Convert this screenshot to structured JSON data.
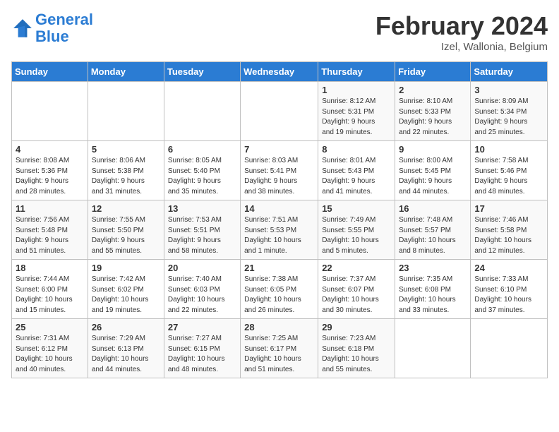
{
  "header": {
    "logo_line1": "General",
    "logo_line2": "Blue",
    "month": "February 2024",
    "location": "Izel, Wallonia, Belgium"
  },
  "weekdays": [
    "Sunday",
    "Monday",
    "Tuesday",
    "Wednesday",
    "Thursday",
    "Friday",
    "Saturday"
  ],
  "weeks": [
    [
      {
        "day": "",
        "info": ""
      },
      {
        "day": "",
        "info": ""
      },
      {
        "day": "",
        "info": ""
      },
      {
        "day": "",
        "info": ""
      },
      {
        "day": "1",
        "info": "Sunrise: 8:12 AM\nSunset: 5:31 PM\nDaylight: 9 hours\nand 19 minutes."
      },
      {
        "day": "2",
        "info": "Sunrise: 8:10 AM\nSunset: 5:33 PM\nDaylight: 9 hours\nand 22 minutes."
      },
      {
        "day": "3",
        "info": "Sunrise: 8:09 AM\nSunset: 5:34 PM\nDaylight: 9 hours\nand 25 minutes."
      }
    ],
    [
      {
        "day": "4",
        "info": "Sunrise: 8:08 AM\nSunset: 5:36 PM\nDaylight: 9 hours\nand 28 minutes."
      },
      {
        "day": "5",
        "info": "Sunrise: 8:06 AM\nSunset: 5:38 PM\nDaylight: 9 hours\nand 31 minutes."
      },
      {
        "day": "6",
        "info": "Sunrise: 8:05 AM\nSunset: 5:40 PM\nDaylight: 9 hours\nand 35 minutes."
      },
      {
        "day": "7",
        "info": "Sunrise: 8:03 AM\nSunset: 5:41 PM\nDaylight: 9 hours\nand 38 minutes."
      },
      {
        "day": "8",
        "info": "Sunrise: 8:01 AM\nSunset: 5:43 PM\nDaylight: 9 hours\nand 41 minutes."
      },
      {
        "day": "9",
        "info": "Sunrise: 8:00 AM\nSunset: 5:45 PM\nDaylight: 9 hours\nand 44 minutes."
      },
      {
        "day": "10",
        "info": "Sunrise: 7:58 AM\nSunset: 5:46 PM\nDaylight: 9 hours\nand 48 minutes."
      }
    ],
    [
      {
        "day": "11",
        "info": "Sunrise: 7:56 AM\nSunset: 5:48 PM\nDaylight: 9 hours\nand 51 minutes."
      },
      {
        "day": "12",
        "info": "Sunrise: 7:55 AM\nSunset: 5:50 PM\nDaylight: 9 hours\nand 55 minutes."
      },
      {
        "day": "13",
        "info": "Sunrise: 7:53 AM\nSunset: 5:51 PM\nDaylight: 9 hours\nand 58 minutes."
      },
      {
        "day": "14",
        "info": "Sunrise: 7:51 AM\nSunset: 5:53 PM\nDaylight: 10 hours\nand 1 minute."
      },
      {
        "day": "15",
        "info": "Sunrise: 7:49 AM\nSunset: 5:55 PM\nDaylight: 10 hours\nand 5 minutes."
      },
      {
        "day": "16",
        "info": "Sunrise: 7:48 AM\nSunset: 5:57 PM\nDaylight: 10 hours\nand 8 minutes."
      },
      {
        "day": "17",
        "info": "Sunrise: 7:46 AM\nSunset: 5:58 PM\nDaylight: 10 hours\nand 12 minutes."
      }
    ],
    [
      {
        "day": "18",
        "info": "Sunrise: 7:44 AM\nSunset: 6:00 PM\nDaylight: 10 hours\nand 15 minutes."
      },
      {
        "day": "19",
        "info": "Sunrise: 7:42 AM\nSunset: 6:02 PM\nDaylight: 10 hours\nand 19 minutes."
      },
      {
        "day": "20",
        "info": "Sunrise: 7:40 AM\nSunset: 6:03 PM\nDaylight: 10 hours\nand 22 minutes."
      },
      {
        "day": "21",
        "info": "Sunrise: 7:38 AM\nSunset: 6:05 PM\nDaylight: 10 hours\nand 26 minutes."
      },
      {
        "day": "22",
        "info": "Sunrise: 7:37 AM\nSunset: 6:07 PM\nDaylight: 10 hours\nand 30 minutes."
      },
      {
        "day": "23",
        "info": "Sunrise: 7:35 AM\nSunset: 6:08 PM\nDaylight: 10 hours\nand 33 minutes."
      },
      {
        "day": "24",
        "info": "Sunrise: 7:33 AM\nSunset: 6:10 PM\nDaylight: 10 hours\nand 37 minutes."
      }
    ],
    [
      {
        "day": "25",
        "info": "Sunrise: 7:31 AM\nSunset: 6:12 PM\nDaylight: 10 hours\nand 40 minutes."
      },
      {
        "day": "26",
        "info": "Sunrise: 7:29 AM\nSunset: 6:13 PM\nDaylight: 10 hours\nand 44 minutes."
      },
      {
        "day": "27",
        "info": "Sunrise: 7:27 AM\nSunset: 6:15 PM\nDaylight: 10 hours\nand 48 minutes."
      },
      {
        "day": "28",
        "info": "Sunrise: 7:25 AM\nSunset: 6:17 PM\nDaylight: 10 hours\nand 51 minutes."
      },
      {
        "day": "29",
        "info": "Sunrise: 7:23 AM\nSunset: 6:18 PM\nDaylight: 10 hours\nand 55 minutes."
      },
      {
        "day": "",
        "info": ""
      },
      {
        "day": "",
        "info": ""
      }
    ]
  ]
}
